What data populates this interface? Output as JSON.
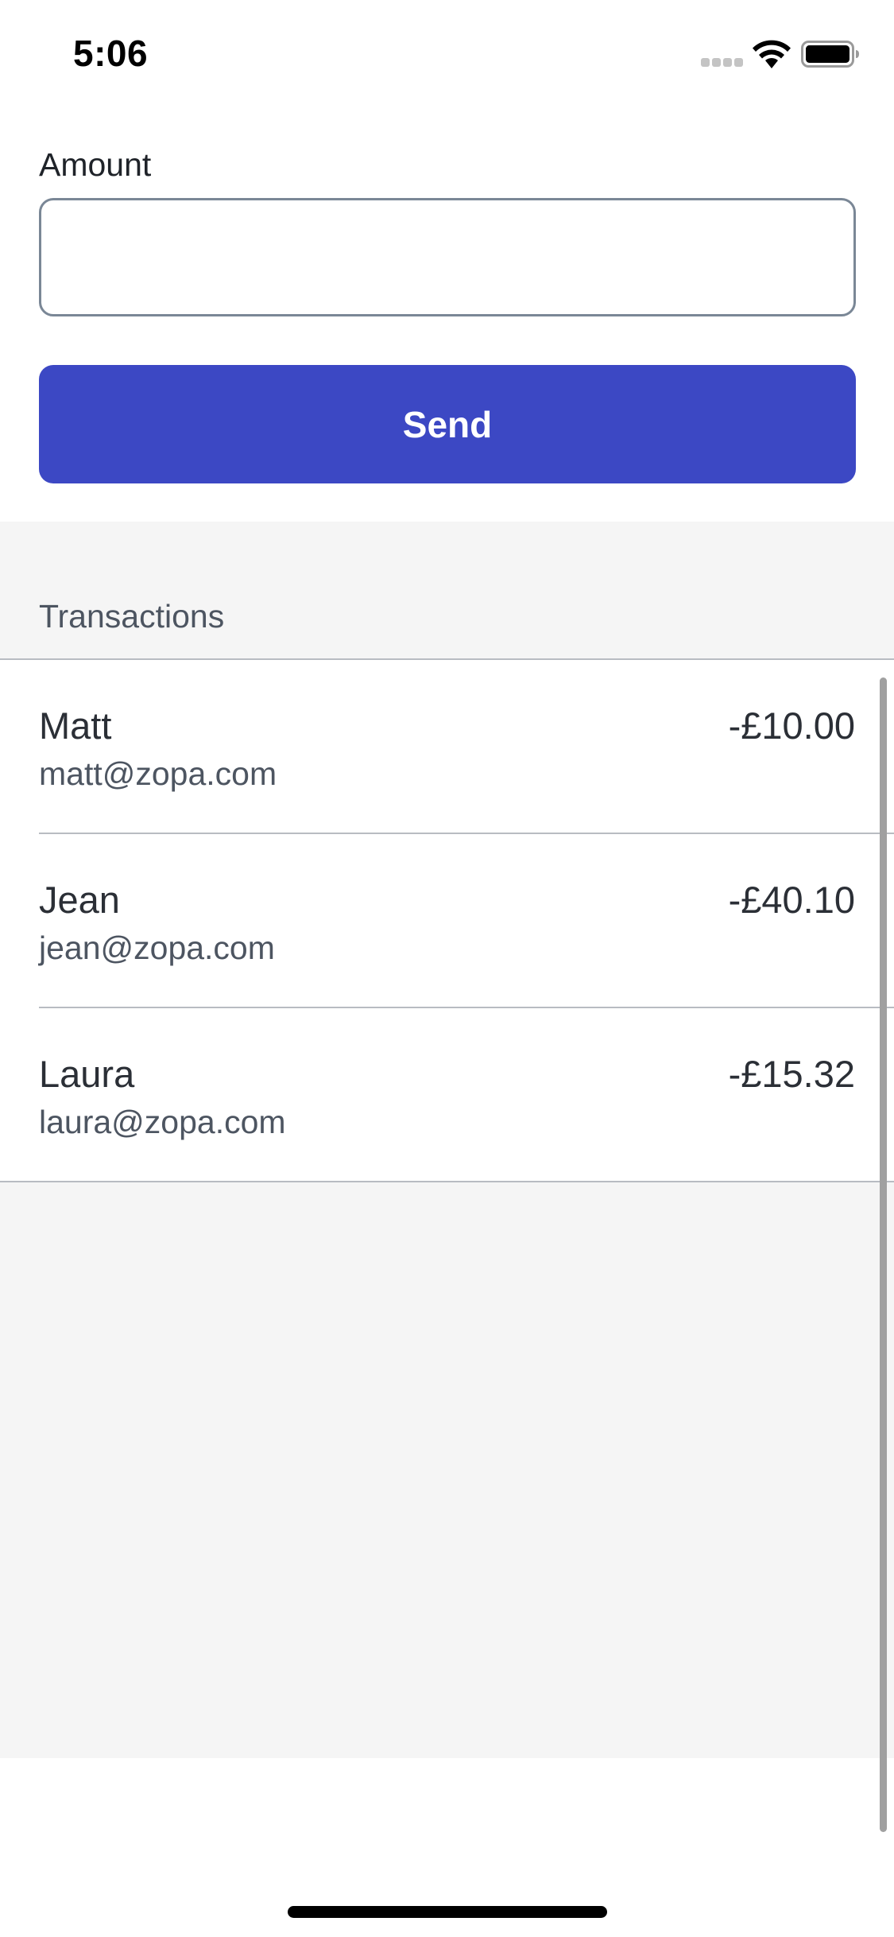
{
  "status_bar": {
    "time": "5:06",
    "icons": [
      "signal-dots-icon",
      "wifi-icon",
      "battery-icon"
    ]
  },
  "form": {
    "amount_label": "Amount",
    "amount_value": "",
    "amount_placeholder": "",
    "send_label": "Send"
  },
  "transactions": {
    "header": "Transactions",
    "items": [
      {
        "name": "Matt",
        "email": "matt@zopa.com",
        "amount": "-£10.00"
      },
      {
        "name": "Jean",
        "email": "jean@zopa.com",
        "amount": "-£40.10"
      },
      {
        "name": "Laura",
        "email": "laura@zopa.com",
        "amount": "-£15.32"
      }
    ]
  },
  "colors": {
    "accent": "#3c48c4",
    "background_grey": "#f5f5f5",
    "text_primary": "#2b2f36",
    "text_secondary": "#4d5561",
    "input_border": "#7a8796"
  }
}
